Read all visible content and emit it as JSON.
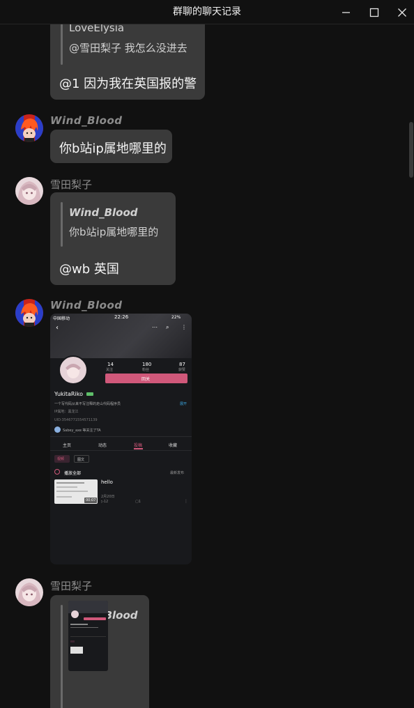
{
  "window": {
    "title": "群聊的聊天记录",
    "minimize_icon": "minimize-icon",
    "maximize_icon": "maximize-icon",
    "close_icon": "close-icon"
  },
  "messages": [
    {
      "quote_name": "LoveElysia",
      "quote_text": "@雪田梨子 我怎么没进去",
      "text": "@1 因为我在英国报的警"
    },
    {
      "sender": "Wind_Blood",
      "text": "你b站ip属地哪里的"
    },
    {
      "sender": "雪田梨子",
      "quote_name": "Wind_Blood",
      "quote_text": "你b站ip属地哪里的",
      "text": "@wb 英国"
    },
    {
      "sender": "Wind_Blood",
      "image": {
        "status_carrier": "中国移动",
        "status_time": "22:26",
        "status_battery": "22%",
        "following": "14",
        "following_label": "关注",
        "followers": "180",
        "followers_label": "粉丝",
        "likes": "87",
        "likes_label": "获赞",
        "follow_button": "回关",
        "username": "YukitaRiko",
        "bio": "一个写代码从来不写注释的走山代码程序员",
        "expand": "展开",
        "ip_location": "IP属地：黑龙江",
        "uid": "UID:3546771554571139",
        "followed_by": "Sabey_axe 等关注了TA",
        "tabs": [
          "主页",
          "动态",
          "投稿",
          "收藏"
        ],
        "active_tab": "投稿",
        "filters": [
          "视频",
          "图文"
        ],
        "play_all": "播放全部",
        "sort": "最新发布",
        "video_title": "hello",
        "video_duration": "00:07",
        "video_date": "2月20日",
        "video_views": "12",
        "video_comments": "1"
      }
    },
    {
      "sender": "雪田梨子",
      "quote_name": "Wind_Blood"
    }
  ],
  "colors": {
    "background": "#111111",
    "bubble": "#3a3a3a",
    "nick": "#8b8b8b",
    "accent_pink": "#d0587a"
  }
}
